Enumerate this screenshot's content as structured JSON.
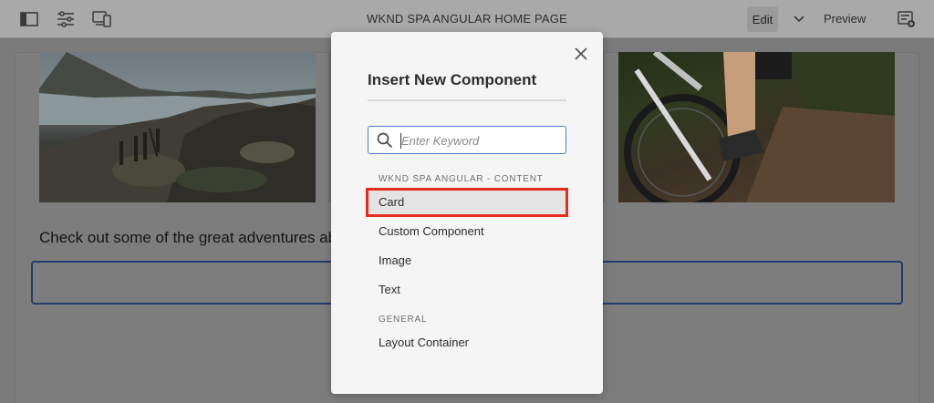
{
  "toolbar": {
    "title": "WKND SPA ANGULAR HOME PAGE",
    "edit_label": "Edit",
    "preview_label": "Preview",
    "icons": [
      "side-panel-icon",
      "properties-icon",
      "emulator-icon",
      "chevron-down-icon",
      "page-info-icon"
    ]
  },
  "page": {
    "body_text": "Check out some of the great adventures ab"
  },
  "dialog": {
    "title": "Insert New Component",
    "search": {
      "placeholder": "Enter Keyword",
      "value": ""
    },
    "groups": [
      {
        "header": "WKND SPA ANGULAR - CONTENT",
        "items": [
          "Card",
          "Custom Component",
          "Image",
          "Text"
        ]
      },
      {
        "header": "GENERAL",
        "items": [
          "Layout Container"
        ]
      }
    ],
    "selected_item": "Card",
    "highlight_color": "#e52c1c"
  }
}
